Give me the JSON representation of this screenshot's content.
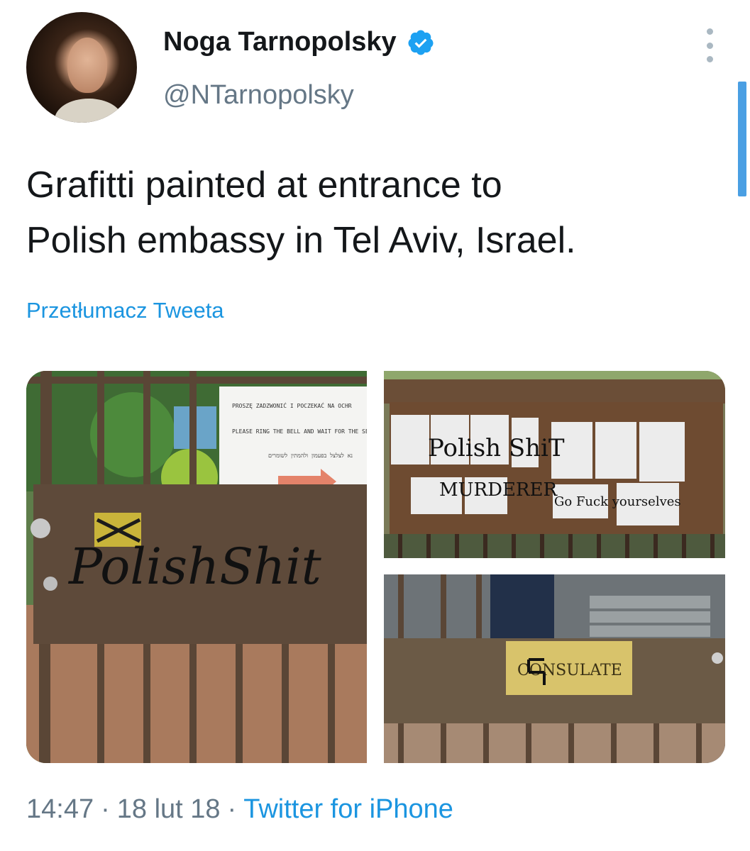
{
  "author": {
    "name": "Noga Tarnopolsky",
    "handle": "@NTarnopolsky",
    "verified": true,
    "avatar_icon": "profile-photo"
  },
  "tweet": {
    "text_line1": "Grafitti painted at entrance to",
    "text_line2": "Polish embassy in Tel Aviv, Israel.",
    "translate_link": "Przetłumacz Tweeta"
  },
  "media": {
    "photo1": {
      "sign_line1": "PROSZĘ ZADZWONIĆ I POCZEKAĆ NA OCHR",
      "sign_line2": "PLEASE RING THE BELL AND WAIT FOR THE SE",
      "sign_line3": "נא לצלצל בפעמון ולהמתין לשומרים",
      "graffiti": "PolishShit"
    },
    "photo2": {
      "graffiti_line1": "Polish ShiT",
      "graffiti_line2": "MURDERER",
      "graffiti_line3": "Go Fuck yourselves"
    },
    "photo3": {
      "plaque": "CONSULATE"
    }
  },
  "meta": {
    "time": "14:47",
    "separator": "·",
    "date": "18 lut 18",
    "source": "Twitter for iPhone"
  },
  "colors": {
    "link": "#1b95e0",
    "secondary_text": "#657786",
    "verified_badge": "#1da1f2",
    "scrollbar": "#4a9fe3"
  }
}
